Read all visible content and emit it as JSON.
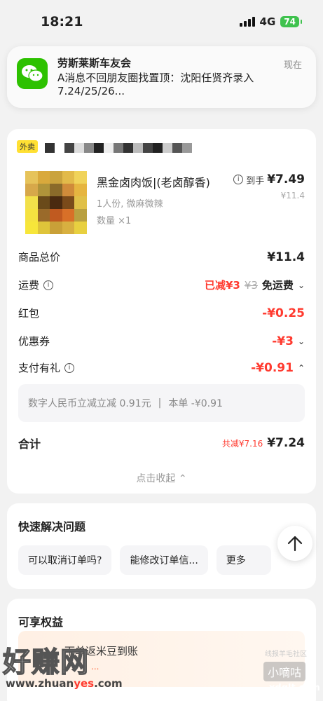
{
  "status_bar": {
    "time": "18:21",
    "network": "4G",
    "battery": "74"
  },
  "notification": {
    "app_icon": "wechat-icon",
    "title": "劳斯莱斯车友会",
    "text": "A消息不回朋友圈找置顶：沈阳任贤齐录入7.24/25/26...",
    "time": "现在"
  },
  "order": {
    "tag": "外卖",
    "item": {
      "name": "黑金卤肉饭|(老卤醇香)",
      "spec": "1人份, 微麻微辣",
      "qty": "数量 ×1",
      "price_label": "到手",
      "price": "¥7.49",
      "original_price": "¥11.4"
    },
    "lines": {
      "goods_total_label": "商品总价",
      "goods_total": "¥11.4",
      "shipping_label": "运费",
      "shipping_reduced": "已减¥3",
      "shipping_orig": "¥3",
      "shipping_value": "免运费",
      "redpack_label": "红包",
      "redpack_value": "-¥0.25",
      "coupon_label": "优惠券",
      "coupon_value": "-¥3",
      "pay_gift_label": "支付有礼",
      "pay_gift_value": "-¥0.91"
    },
    "pay_detail": {
      "left": "数字人民币立减立减 0.91元",
      "sep": "|",
      "right": "本单 -¥0.91"
    },
    "total": {
      "label": "合计",
      "saved": "共减¥7.16",
      "price": "¥7.24"
    },
    "collapse": "点击收起"
  },
  "faq": {
    "title": "快速解决问题",
    "chips": [
      "可以取消订单吗?",
      "能修改订单信...",
      "更多"
    ]
  },
  "rights": {
    "title": "可享权益",
    "banner_text": "下单返米豆到账",
    "banner_sub": "..."
  },
  "watermark": {
    "left": "好赚网",
    "url_prefix": "www.zhuan",
    "url_mid": "yes",
    "url_suffix": ".com",
    "right_top": "线报羊毛社区",
    "right_logo": "小嘀咕",
    "right_url": "xdglt.com"
  }
}
